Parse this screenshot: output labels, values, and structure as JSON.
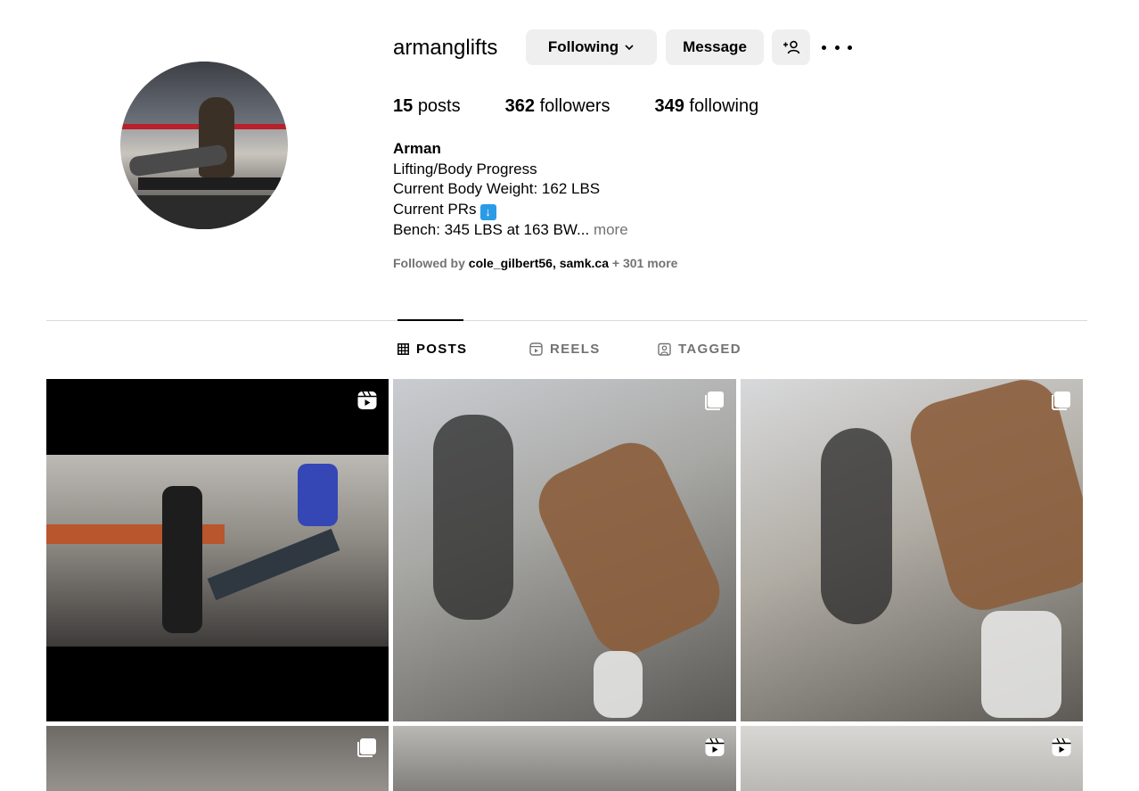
{
  "profile": {
    "username": "armanglifts",
    "following_button": "Following",
    "message_button": "Message",
    "stats": [
      {
        "count": "15",
        "label": "posts"
      },
      {
        "count": "362",
        "label": "followers"
      },
      {
        "count": "349",
        "label": "following"
      }
    ],
    "bio": {
      "name": "Arman",
      "line1": "Lifting/Body Progress",
      "line2": "Current Body Weight: 162 LBS",
      "line3": "Current PRs",
      "line4": "Bench: 345 LBS at 163 BW...",
      "more": "more"
    },
    "followed_by": {
      "prefix": "Followed by",
      "account1": "cole_gilbert56",
      "separator": ",",
      "account2": "samk.ca",
      "suffix": "+ 301 more"
    }
  },
  "tabs": [
    {
      "label": "POSTS",
      "icon": "grid-icon",
      "active": true
    },
    {
      "label": "REELS",
      "icon": "reels-icon",
      "active": false
    },
    {
      "label": "TAGGED",
      "icon": "tagged-icon",
      "active": false
    }
  ],
  "posts": [
    {
      "type": "reel",
      "icon": "reel-icon"
    },
    {
      "type": "carousel",
      "icon": "carousel-icon"
    },
    {
      "type": "carousel",
      "icon": "carousel-icon"
    },
    {
      "type": "carousel",
      "icon": "carousel-icon"
    },
    {
      "type": "reel",
      "icon": "reel-icon"
    },
    {
      "type": "reel",
      "icon": "reel-icon"
    }
  ],
  "colors": {
    "button_bg": "#efefef",
    "muted_text": "#737373",
    "divider": "#dbdbdb",
    "pr_icon_blue": "#2b9be6"
  }
}
